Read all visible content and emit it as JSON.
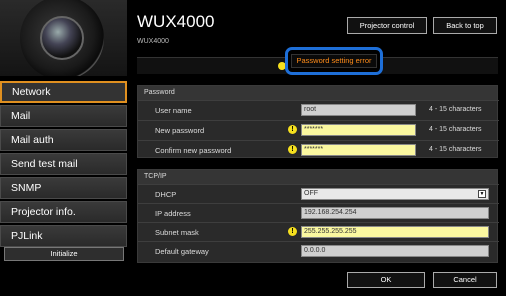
{
  "header": {
    "title": "WUX4000",
    "subtitle": "WUX4000",
    "projector_control_label": "Projector control",
    "back_to_top_label": "Back to top"
  },
  "error": {
    "message": "Password setting error"
  },
  "sidebar": {
    "items": [
      {
        "label": "Network",
        "active": true
      },
      {
        "label": "Mail"
      },
      {
        "label": "Mail auth"
      },
      {
        "label": "Send test mail"
      },
      {
        "label": "SNMP"
      },
      {
        "label": "Projector info."
      },
      {
        "label": "PJLink"
      }
    ],
    "initialize_label": "Initialize"
  },
  "password_section": {
    "heading": "Password",
    "rows": [
      {
        "label": "User name",
        "value": "root",
        "hint": "4 - 15 characters"
      },
      {
        "label": "New password",
        "value": "*******",
        "hint": "4 - 15 characters"
      },
      {
        "label": "Confirm new password",
        "value": "*******",
        "hint": "4 - 15 characters"
      }
    ]
  },
  "tcpip_section": {
    "heading": "TCP/IP",
    "rows": [
      {
        "label": "DHCP",
        "value": "OFF"
      },
      {
        "label": "IP address",
        "value": "192.168.254.254"
      },
      {
        "label": "Subnet mask",
        "value": "255.255.255.255"
      },
      {
        "label": "Default gateway",
        "value": "0.0.0.0"
      }
    ]
  },
  "footer": {
    "ok_label": "OK",
    "cancel_label": "Cancel"
  },
  "colors": {
    "accent": "#e09020",
    "error_text": "#ff8c1a",
    "highlight_border": "#1e6fd8",
    "warning": "#f6e01e",
    "invalid_field": "#fbf8a0"
  }
}
